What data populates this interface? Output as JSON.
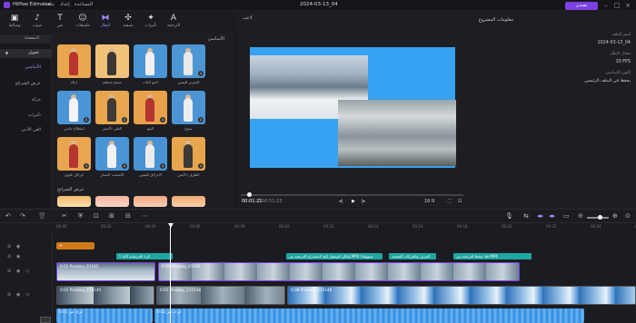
{
  "app": {
    "name": "HitPaw Edimakor",
    "project_title": "2024-03-13_04"
  },
  "menu": [
    "ملف",
    "إعداد",
    "المساعدة"
  ],
  "export_label": "تصدير",
  "toolbar": [
    {
      "label": "وسائط",
      "icon": "media-icon"
    },
    {
      "label": "صوت",
      "icon": "audio-icon"
    },
    {
      "label": "نص",
      "icon": "text-icon"
    },
    {
      "label": "ملصقات",
      "icon": "sticker-icon"
    },
    {
      "label": "انتقال",
      "icon": "transition-icon",
      "active": true
    },
    {
      "label": "تصفية",
      "icon": "filter-icon"
    },
    {
      "label": "تأثيرات",
      "icon": "effects-icon"
    },
    {
      "label": "الترجمة",
      "icon": "subtitle-icon"
    }
  ],
  "categories": {
    "header": "المفضلة",
    "group": "تحويل",
    "items": [
      "الأساسي",
      "عرض الشرائح",
      "حركة",
      "تأثيرات",
      "الفن الأدنى"
    ]
  },
  "assets": {
    "section1_title": "الأساسي",
    "section2_title": "عرض الشرائح",
    "items": [
      {
        "label": "ازالة"
      },
      {
        "label": "مسح منتظم"
      },
      {
        "label": "لامع الباب"
      },
      {
        "label": "التمرير لليمين"
      },
      {
        "label": "انقطاع جانبي"
      },
      {
        "label": "الطي الأيسر"
      },
      {
        "label": "البيع"
      },
      {
        "label": "يتنوع"
      },
      {
        "label": "انزلاق علوي"
      },
      {
        "label": "الاسحب اليسار"
      },
      {
        "label": "الانزلاق لليمين"
      },
      {
        "label": "الطرف الأيمن"
      }
    ]
  },
  "player": {
    "label": "لاعب",
    "current_time": "00:01:21",
    "total_time": "00:51:23",
    "ratio": "16:9",
    "progress": 0.03
  },
  "project_info": {
    "title": "معلومات المشروع",
    "rows": [
      {
        "label": "اسم الملف",
        "value": "2024-03-13_04"
      },
      {
        "label": "معدل الإطار",
        "value": "30 FPS"
      },
      {
        "label": "اللون الاساسي",
        "value": "يحفظ في الملف الرئيسي"
      }
    ]
  },
  "ruler": [
    "00:00",
    "00:02",
    "00:04",
    "00:06",
    "00:08",
    "00:10",
    "00:12",
    "00:14",
    "00:16",
    "00:18",
    "00:20",
    "00:22",
    "00:24",
    "00:26"
  ],
  "tracks": {
    "captions": [
      "كرة الخرسانة لأنك ؟",
      "إمكان الوصول إليه لاستخراج الترجمة من MP4 بسهولة؟",
      "الحرف والحركات المقصد",
      "فك ضغط الترجمة من MP4"
    ],
    "video_clips": [
      {
        "label": "0:01 Pixabay_91545"
      },
      {
        "label": "0:01 Pixabay_91545"
      }
    ],
    "video2_clips": [
      {
        "label": "0:01 Pixabay_215145"
      },
      {
        "label": "0:01 Pixabay_215148"
      },
      {
        "label": "0:08 Pixabay_215148"
      }
    ],
    "audio_clips": [
      {
        "label": "0:01 اترك عبر"
      },
      {
        "label": "0:01 اترك عبر"
      }
    ]
  },
  "colors": {
    "accent": "#7b3fe4",
    "caption": "#1fa7a1",
    "canvas_bg": "#37a2f1"
  }
}
